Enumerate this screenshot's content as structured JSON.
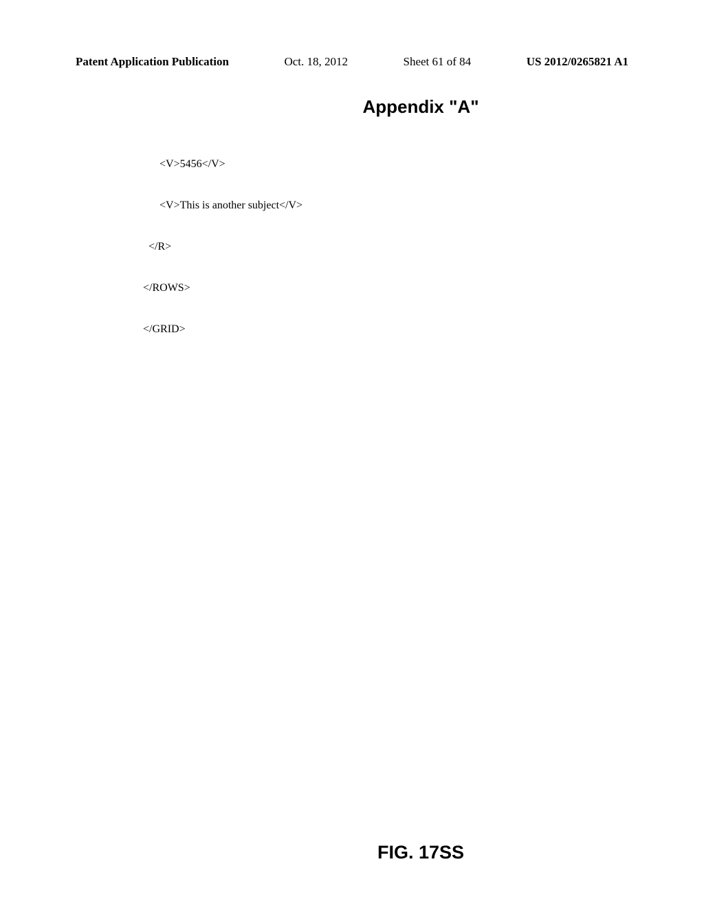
{
  "header": {
    "publication_type": "Patent Application Publication",
    "date": "Oct. 18, 2012",
    "sheet_info": "Sheet 61 of 84",
    "publication_number": "US 2012/0265821 A1"
  },
  "appendix": {
    "title": "Appendix \"A\""
  },
  "code": {
    "lines": [
      "        <V>5456</V>",
      "        <V>This is another subject</V>",
      "    </R>",
      "  </ROWS>",
      "  </GRID>"
    ]
  },
  "figure": {
    "label": "FIG. 17SS"
  }
}
